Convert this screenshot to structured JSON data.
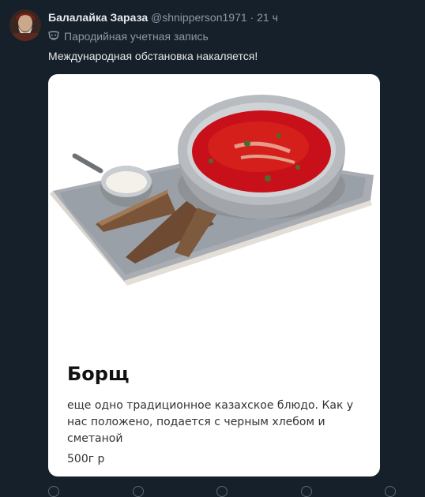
{
  "tweet": {
    "author_name": "Балалайка Зараза",
    "handle": "@shnipperson1971",
    "separator": "·",
    "time": "21 ч",
    "parody_label": "Пародийная учетная запись",
    "text": "Международная обстановка накаляется!"
  },
  "card": {
    "title": "Борщ",
    "description": "еще одно традиционное казахское блюдо. Как у нас положено, подается с черным хлебом и сметаной",
    "price": "500г р"
  },
  "colors": {
    "background": "#15202b",
    "borscht": "#c8101a"
  }
}
